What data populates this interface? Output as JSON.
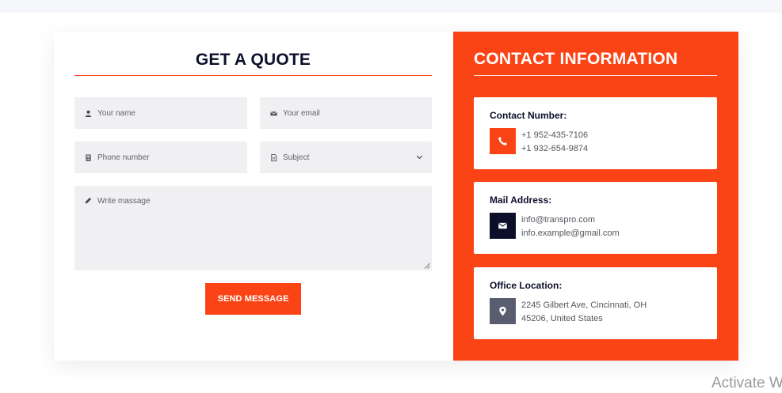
{
  "quote_form": {
    "title": "GET A QUOTE",
    "name_placeholder": "Your name",
    "email_placeholder": "Your email",
    "phone_placeholder": "Phone number",
    "subject_placeholder": "Subject",
    "message_placeholder": "Write massage",
    "submit_label": "SEND MESSAGE"
  },
  "contact_info": {
    "title": "CONTACT INFORMATION",
    "phone": {
      "label": "Contact Number:",
      "icon": "phone-icon",
      "lines": [
        "+1 952-435-7106",
        "+1 932-654-9874"
      ]
    },
    "mail": {
      "label": "Mail Address:",
      "icon": "envelope-icon",
      "lines": [
        "info@transpro.com",
        "info.example@gmail.com"
      ]
    },
    "office": {
      "label": "Office Location:",
      "icon": "map-pin-icon",
      "lines": [
        "2245 Gilbert Ave, Cincinnati, OH",
        "45206, United States"
      ]
    }
  },
  "watermark": "Activate W",
  "colors": {
    "accent": "#fb4416",
    "navy": "#0b0f2a",
    "slate": "#595d70",
    "field_bg": "#f0f0f2"
  }
}
